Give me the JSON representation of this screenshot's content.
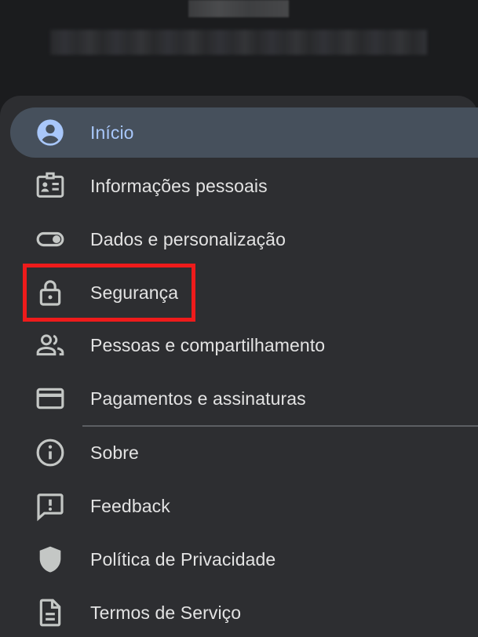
{
  "menu": {
    "items": [
      {
        "id": "inicio",
        "label": "Início",
        "icon": "account-circle-icon",
        "active": true
      },
      {
        "id": "informacoes",
        "label": "Informações pessoais",
        "icon": "id-card-icon"
      },
      {
        "id": "dados",
        "label": "Dados e personalização",
        "icon": "toggle-icon"
      },
      {
        "id": "seguranca",
        "label": "Segurança",
        "icon": "lock-icon"
      },
      {
        "id": "pessoas",
        "label": "Pessoas e compartilhamento",
        "icon": "people-icon"
      },
      {
        "id": "pagamentos",
        "label": "Pagamentos e assinaturas",
        "icon": "credit-card-icon"
      },
      {
        "id": "sobre",
        "label": "Sobre",
        "icon": "info-icon"
      },
      {
        "id": "feedback",
        "label": "Feedback",
        "icon": "feedback-icon"
      },
      {
        "id": "privacidade",
        "label": "Política de Privacidade",
        "icon": "shield-icon"
      },
      {
        "id": "termos",
        "label": "Termos de Serviço",
        "icon": "document-icon"
      }
    ]
  },
  "colors": {
    "background": "#1b1c1e",
    "drawer": "#2d2e31",
    "active_pill": "#46505c",
    "active_text": "#a8c7fa",
    "text": "#e3e3e3",
    "icon": "#c4c7c5",
    "highlight": "#ee1b1b"
  }
}
